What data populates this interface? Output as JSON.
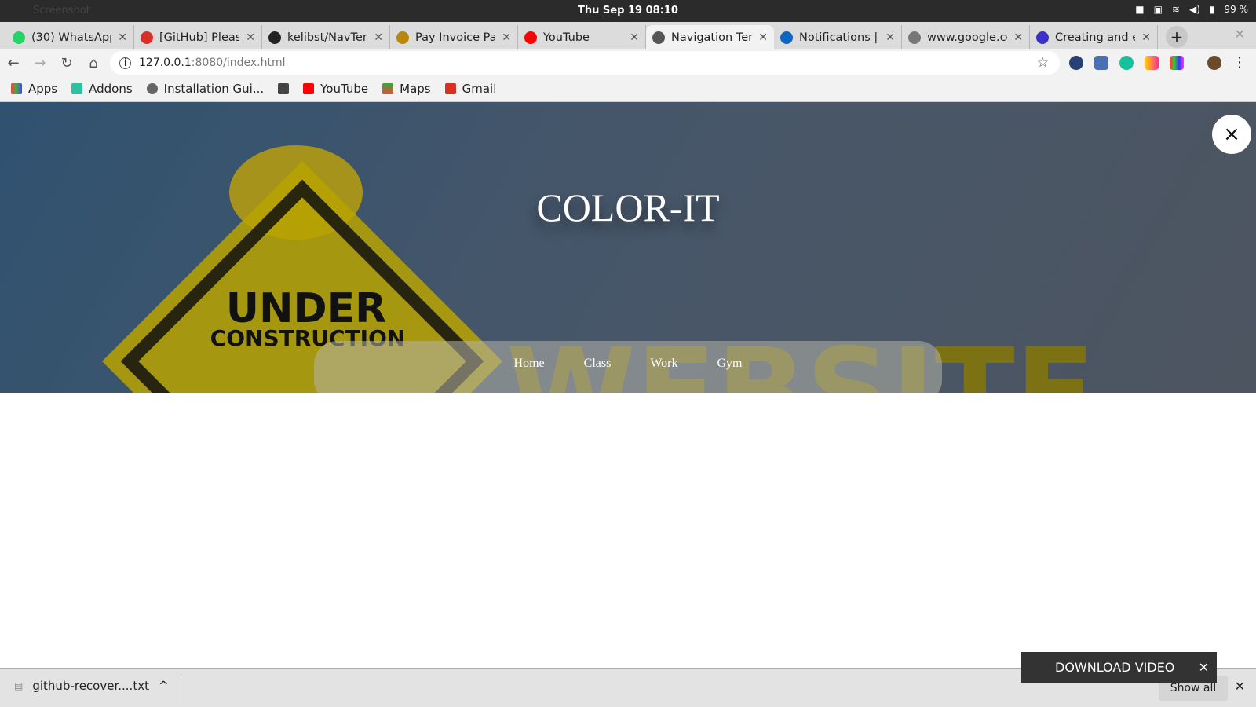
{
  "os": {
    "app_name": "Screenshot",
    "clock": "Thu Sep 19  08:10",
    "battery": "99 %"
  },
  "tabs": [
    {
      "label": "(30) WhatsApp",
      "icon": "whatsapp-icon",
      "color": "#25d366"
    },
    {
      "label": "[GitHub] Please",
      "icon": "gmail-icon",
      "color": "#d93025"
    },
    {
      "label": "kelibst/NavTem",
      "icon": "github-icon",
      "color": "#222222"
    },
    {
      "label": "Pay Invoice Page",
      "icon": "invoice-icon",
      "color": "#b8860b"
    },
    {
      "label": "YouTube",
      "icon": "youtube-icon",
      "color": "#ff0000"
    },
    {
      "label": "Navigation Tem",
      "icon": "globe-icon",
      "color": "#555555",
      "active": true
    },
    {
      "label": "Notifications | L",
      "icon": "linkedin-icon",
      "color": "#0a66c2"
    },
    {
      "label": "www.google.com",
      "icon": "globe-icon",
      "color": "#777777"
    },
    {
      "label": "Creating and e",
      "icon": "moon-icon",
      "color": "#3b30c9"
    }
  ],
  "address": {
    "host": "127.0.0.1",
    "path": ":8080/index.html"
  },
  "bookmarks": [
    {
      "label": "Apps",
      "icon": "apps-icon"
    },
    {
      "label": "Addons",
      "icon": "puzzle-icon"
    },
    {
      "label": "Installation Gui...",
      "icon": "globe-icon"
    },
    {
      "label": "",
      "icon": "folder-icon"
    },
    {
      "label": "YouTube",
      "icon": "youtube-icon"
    },
    {
      "label": "Maps",
      "icon": "maps-icon"
    },
    {
      "label": "Gmail",
      "icon": "gmail-icon"
    }
  ],
  "hero": {
    "title": "COLOR-IT",
    "sign_line1": "UNDER",
    "sign_line2": "CONSTRUCTION",
    "sign_word": "WEBSITE",
    "close": "×"
  },
  "menu": [
    "Home",
    "Class",
    "Work",
    "Gym"
  ],
  "downloads": {
    "file": "github-recover....txt",
    "show_all": "Show all",
    "popup": "DOWNLOAD VIDEO"
  }
}
